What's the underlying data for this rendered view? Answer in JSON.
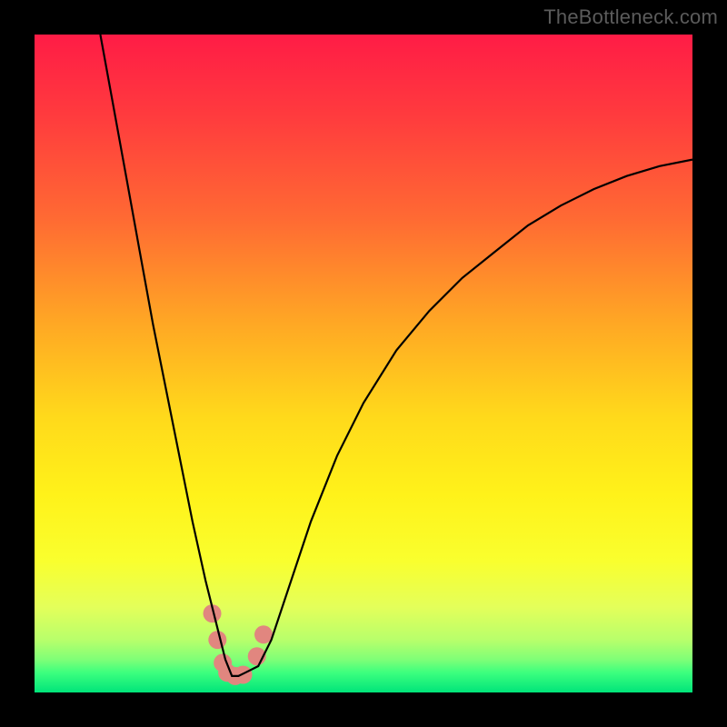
{
  "watermark": "TheBottleneck.com",
  "chart_data": {
    "type": "line",
    "title": "",
    "xlabel": "",
    "ylabel": "",
    "xlim": [
      0,
      100
    ],
    "ylim": [
      0,
      100
    ],
    "grid": false,
    "series": [
      {
        "name": "curve",
        "x": [
          10,
          12,
          14,
          16,
          18,
          20,
          22,
          24,
          26,
          28,
          29,
          30,
          31,
          32,
          34,
          36,
          38,
          42,
          46,
          50,
          55,
          60,
          65,
          70,
          75,
          80,
          85,
          90,
          95,
          100
        ],
        "y": [
          100,
          89,
          78,
          67,
          56,
          46,
          36,
          26,
          17,
          9,
          5,
          2.5,
          2.5,
          3,
          4,
          8,
          14,
          26,
          36,
          44,
          52,
          58,
          63,
          67,
          71,
          74,
          76.5,
          78.5,
          80,
          81
        ]
      }
    ],
    "markers": {
      "name": "highlight",
      "points": [
        {
          "x": 27.0,
          "y": 12.0
        },
        {
          "x": 27.8,
          "y": 8.0
        },
        {
          "x": 28.6,
          "y": 4.5
        },
        {
          "x": 29.3,
          "y": 3.0
        },
        {
          "x": 30.5,
          "y": 2.5
        },
        {
          "x": 31.7,
          "y": 2.7
        },
        {
          "x": 33.8,
          "y": 5.5
        },
        {
          "x": 34.8,
          "y": 8.8
        }
      ],
      "radius": 10
    },
    "colors": {
      "curve": "#000000",
      "marker": "#e1867f",
      "gradient_top": "#ff1c46",
      "gradient_bottom": "#00e47a"
    }
  }
}
